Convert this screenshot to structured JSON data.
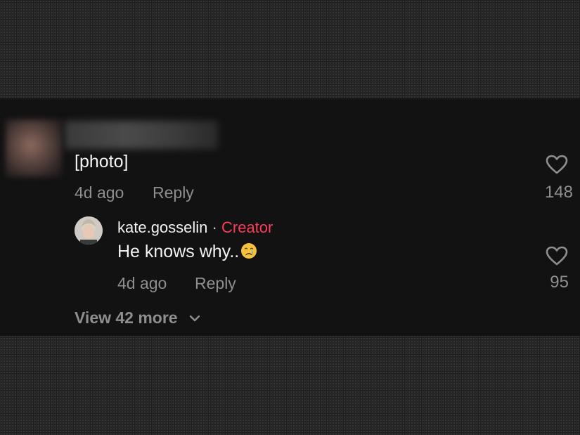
{
  "comment": {
    "text": "[photo]",
    "time": "4d ago",
    "reply_label": "Reply",
    "likes": "148"
  },
  "reply": {
    "username": "kate.gosselin",
    "separator": "·",
    "badge": "Creator",
    "text": "He knows why..",
    "emoji": "crying-face",
    "time": "4d ago",
    "reply_label": "Reply",
    "likes": "95"
  },
  "view_more_label": "View 42 more",
  "colors": {
    "creator_badge": "#ff3b5c",
    "panel_bg": "#121212",
    "muted_text": "#8e8e8e"
  }
}
